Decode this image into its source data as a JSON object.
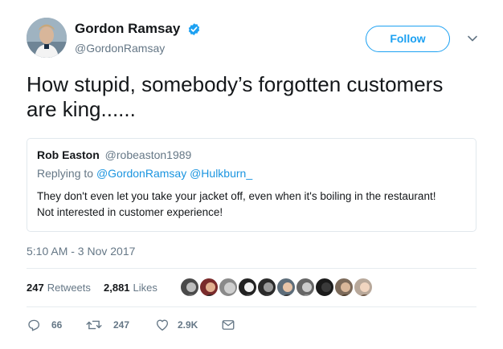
{
  "colors": {
    "accent": "#1da1f2",
    "text": "#14171a",
    "muted": "#657786",
    "border": "#e1e8ed"
  },
  "author": {
    "display_name": "Gordon Ramsay",
    "handle": "@GordonRamsay",
    "verified": true,
    "follow_label": "Follow"
  },
  "tweet": {
    "text": "How stupid, somebody’s forgotten customers are king......",
    "timestamp": "5:10 AM - 3 Nov 2017"
  },
  "quoted": {
    "name": "Rob Easton",
    "handle": "@robeaston1989",
    "replying_to_prefix": "Replying to",
    "replying_to_handles": "@GordonRamsay @Hulkburn_",
    "text_line1": "They don't even let you take your jacket off, even when it's boiling in the restaurant!",
    "text_line2": "Not interested in customer experience!"
  },
  "stats": {
    "retweets_count": "247",
    "retweets_label": "Retweets",
    "likes_count": "2,881",
    "likes_label": "Likes",
    "liker_avatars": 10
  },
  "actions": {
    "replies": "66",
    "retweets": "247",
    "likes": "2.9K"
  },
  "icons": [
    "verified-badge-icon",
    "chevron-down-icon",
    "reply-icon",
    "retweet-icon",
    "heart-icon",
    "message-icon"
  ]
}
